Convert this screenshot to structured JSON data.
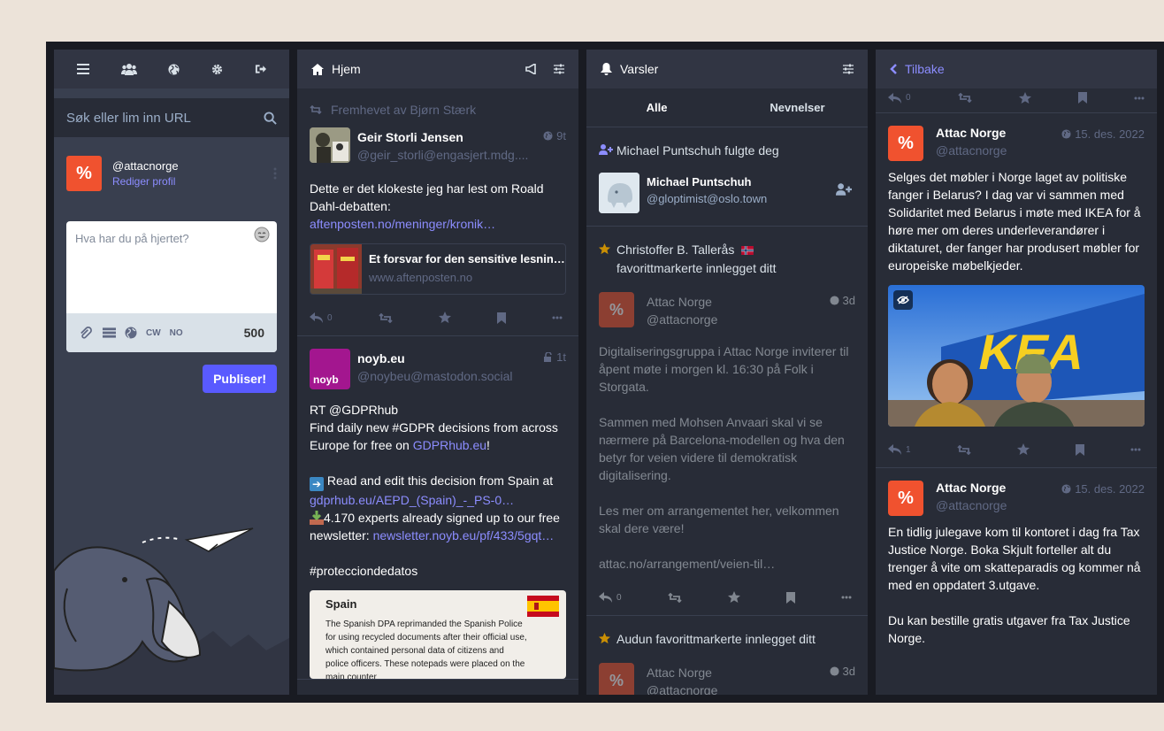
{
  "compose": {
    "search_placeholder": "Søk eller lim inn URL",
    "account_handle": "@attacnorge",
    "edit_profile": "Rediger profil",
    "placeholder": "Hva har du på hjertet?",
    "cw": "CW",
    "language": "NO",
    "char_count": "500",
    "publish": "Publiser!"
  },
  "home": {
    "title": "Hjem",
    "boosted_by": "Fremhevet av Bjørn Stærk",
    "s1": {
      "name": "Geir Storli Jensen",
      "acct": "@geir_storli@engasjert.mdg....",
      "time": "9t",
      "text": "Dette er det klokeste jeg har lest om Roald Dahl-debatten:",
      "link": "aftenposten.no/meninger/kronik…",
      "card_title": "Et forsvar for den sensitive lesning...",
      "card_url": "www.aftenposten.no",
      "replies": "0"
    },
    "s2": {
      "name": "noyb.eu",
      "avatar_text": "noyb",
      "acct": "@noybeu@mastodon.social",
      "time": "1t",
      "l1": "RT @GDPRhub",
      "l2": "Find daily new #GDPR decisions from across Europe for free on ",
      "l2_link": "GDPRhub.eu",
      "l2_end": "!",
      "l3": " Read and edit this decision from Spain at ",
      "l3_link": "gdprhub.eu/AEPD_(Spain)_-_PS-0…",
      "l4": "4.170 experts already signed up to our free newsletter: ",
      "l4_link": "newsletter.noyb.eu/pf/433/5gqt…",
      "hashtag": "#protecciondedatos",
      "doc_title": "Spain",
      "doc_body": "The Spanish DPA reprimanded the Spanish Police for using recycled documents after their official use, which contained personal data of citizens and police officers. These notepads were placed on the main counter"
    }
  },
  "notifications": {
    "title": "Varsler",
    "tab_all": "Alle",
    "tab_mentions": "Nevnelser",
    "follow": {
      "text": "Michael Puntschuh fulgte deg",
      "name": "Michael Puntschuh",
      "acct": "@gloptimist@oslo.town"
    },
    "fav1": {
      "text": "Christoffer B. Tallerås",
      "text2": "favorittmarkerte innlegget ditt",
      "name": "Attac Norge",
      "acct": "@attacnorge",
      "time": "3d",
      "p1": "Digitaliseringsgruppa i Attac Norge inviterer til åpent møte i morgen kl. 16:30 på Folk i Storgata.",
      "p2": "Sammen med Mohsen Anvaari skal vi se nærmere på Barcelona-modellen og hva den betyr for veien videre til demokratisk digitalisering.",
      "p3": "Les mer om arrangementet her, velkommen skal dere være!",
      "p4": "attac.no/arrangement/veien-til…",
      "replies": "0"
    },
    "fav2": {
      "text": "Audun favorittmarkerte innlegget ditt",
      "name": "Attac Norge",
      "acct": "@attacnorge",
      "time": "3d"
    }
  },
  "detail": {
    "back": "Tilbake",
    "top_replies": "0",
    "s1": {
      "name": "Attac Norge",
      "acct": "@attacnorge",
      "time": "15. des. 2022",
      "text": "Selges det møbler i Norge laget av politiske fanger i Belarus? I dag var vi sammen med Solidaritet med Belarus i møte med IKEA for å høre mer om deres underleverandører i diktaturet, der fanger har produsert møbler for europeiske møbelkjeder.",
      "replies": "1"
    },
    "s2": {
      "name": "Attac Norge",
      "acct": "@attacnorge",
      "time": "15. des. 2022",
      "p1": "En tidlig julegave kom til kontoret i dag fra Tax Justice Norge. Boka Skjult forteller alt du trenger å vite om skatteparadis og kommer nå med en oppdatert 3.utgave.",
      "p2": "Du kan bestille gratis utgaver fra Tax Justice Norge."
    }
  },
  "colors": {
    "accent": "#595aff",
    "link": "#8c8dff",
    "attac": "#f0522f",
    "star": "#ca8f04"
  }
}
